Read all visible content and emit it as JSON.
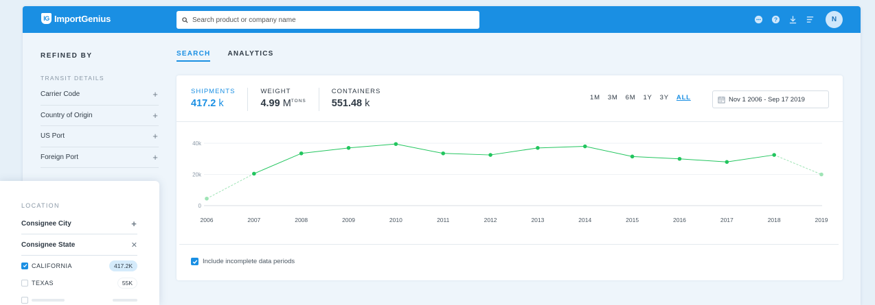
{
  "brand": {
    "mark": "IG",
    "name": "ImportGenius",
    "accent": "#1a8fe3"
  },
  "search": {
    "placeholder": "Search product or company name"
  },
  "topbar": {
    "icons": [
      "chat-icon",
      "help-icon",
      "download-icon",
      "list-icon"
    ],
    "avatar_initial": "N"
  },
  "sidebar": {
    "title": "REFINED BY",
    "transit_label": "TRANSIT DETAILS",
    "transit_items": [
      {
        "label": "Carrier Code"
      },
      {
        "label": "Country of Origin"
      },
      {
        "label": "US Port"
      },
      {
        "label": "Foreign Port"
      }
    ],
    "location_label": "LOCATION",
    "location_items": [
      {
        "label": "Consignee City"
      },
      {
        "label": "Consignee State"
      }
    ],
    "states": [
      {
        "label": "CALIFORNIA",
        "count": "417.2K",
        "checked": true
      },
      {
        "label": "TEXAS",
        "count": "55K",
        "checked": false
      }
    ]
  },
  "tabs": [
    {
      "label": "SEARCH",
      "active": true
    },
    {
      "label": "ANALYTICS",
      "active": false
    }
  ],
  "stats": {
    "shipments": {
      "label": "SHIPMENTS",
      "value": "417.2",
      "unit": "k"
    },
    "weight": {
      "label": "WEIGHT",
      "value": "4.99",
      "unit": "M",
      "sup": "TONS"
    },
    "containers": {
      "label": "CONTAINERS",
      "value": "551.48",
      "unit": "k"
    }
  },
  "ranges": [
    "1M",
    "3M",
    "6M",
    "1Y",
    "3Y",
    "ALL"
  ],
  "active_range": "ALL",
  "date_range": "Nov 1 2006 - Sep 17 2019",
  "include_incomplete": "Include incomplete data periods",
  "chart_data": {
    "type": "line",
    "x": [
      "2006",
      "2007",
      "2008",
      "2009",
      "2010",
      "2011",
      "2012",
      "2013",
      "2014",
      "2015",
      "2016",
      "2017",
      "2018",
      "2019"
    ],
    "series": [
      {
        "values": [
          4500,
          20500,
          33500,
          37000,
          39500,
          33500,
          32500,
          37000,
          38000,
          31500,
          30000,
          28000,
          32500,
          20000
        ],
        "color": "#22c55e"
      }
    ],
    "incomplete_points": [
      "2006",
      "2019"
    ],
    "y_ticks": [
      "0",
      "20k",
      "40k"
    ],
    "ylim": [
      0,
      40000
    ],
    "grid": true
  }
}
